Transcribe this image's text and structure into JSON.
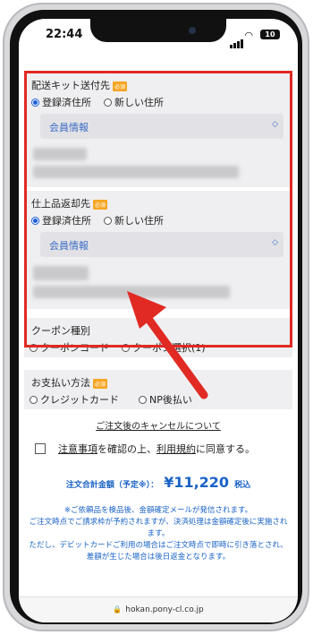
{
  "status": {
    "time": "22:44",
    "battery": "10"
  },
  "delivery": {
    "title": "配送キット送付先",
    "required_badge": "必須",
    "option_registered": "登録済住所",
    "option_new": "新しい住所",
    "select_value": "会員情報"
  },
  "return": {
    "title": "仕上品返却先",
    "required_badge": "必須",
    "option_registered": "登録済住所",
    "option_new": "新しい住所",
    "select_value": "会員情報"
  },
  "coupon": {
    "title": "クーポン種別",
    "option_code": "クーポンコード",
    "option_select": "クーポン選択(1)"
  },
  "payment": {
    "title": "お支払い方法",
    "required_badge": "必須",
    "option_card": "クレジットカード",
    "option_np": "NP後払い"
  },
  "cancel_link": "ご注文後のキャンセルについて",
  "agree": {
    "link1": "注意事項",
    "text1": "を確認の上、",
    "link2": "利用規約",
    "text2": "に同意する。"
  },
  "total": {
    "label": "注文合計金額（予定※）：",
    "amount": "¥11,220",
    "tax": "税込"
  },
  "notes": {
    "line1": "※ご依頼品を検品後、金額確定メールが発信されます。",
    "line2": "ご注文時点でご請求枠が予約されますが、決済処理は金額確定後に実施されます。",
    "line3": "ただし、デビットカードご利用の場合はご注文時点で即時に引き落とされ、差額が生じた場合は後日返金となります。"
  },
  "url": "hokan.pony-cl.co.jp",
  "colors": {
    "accent": "#1a63c6",
    "highlight": "#e02a23",
    "badge": "#f5a623"
  }
}
